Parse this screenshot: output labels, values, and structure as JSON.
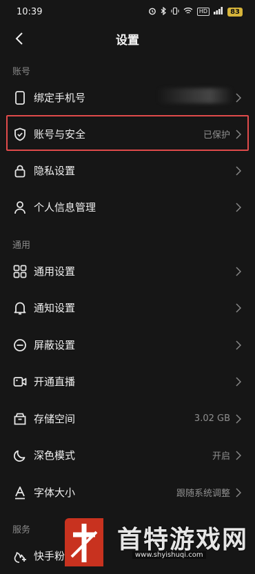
{
  "status_bar": {
    "time": "10:39",
    "battery": "83",
    "hd": "HD"
  },
  "header": {
    "title": "设置"
  },
  "sections": {
    "account": "账号",
    "general": "通用",
    "service": "服务"
  },
  "account_items": [
    {
      "label": "绑定手机号",
      "value": "",
      "icon": "phone-icon"
    },
    {
      "label": "账号与安全",
      "value": "已保护",
      "icon": "shield-icon"
    },
    {
      "label": "隐私设置",
      "value": "",
      "icon": "lock-icon"
    },
    {
      "label": "个人信息管理",
      "value": "",
      "icon": "person-icon"
    }
  ],
  "general_items": [
    {
      "label": "通用设置",
      "value": "",
      "icon": "grid-icon"
    },
    {
      "label": "通知设置",
      "value": "",
      "icon": "bell-icon"
    },
    {
      "label": "屏蔽设置",
      "value": "",
      "icon": "block-icon"
    },
    {
      "label": "开通直播",
      "value": "",
      "icon": "video-camera-icon"
    },
    {
      "label": "存储空间",
      "value": "3.02 GB",
      "icon": "storage-icon"
    },
    {
      "label": "深色模式",
      "value": "开启",
      "icon": "moon-icon"
    },
    {
      "label": "字体大小",
      "value": "跟随系统调整",
      "icon": "font-size-icon"
    }
  ],
  "service_items": [
    {
      "label": "快手粉条",
      "value": "",
      "icon": "sparkle-icon"
    }
  ],
  "watermark": {
    "text": "首特游戏网",
    "url": "www.shyishuqi.com"
  },
  "colors": {
    "background": "#161616",
    "highlight": "#e14b4b",
    "muted": "#8f8f8f"
  }
}
